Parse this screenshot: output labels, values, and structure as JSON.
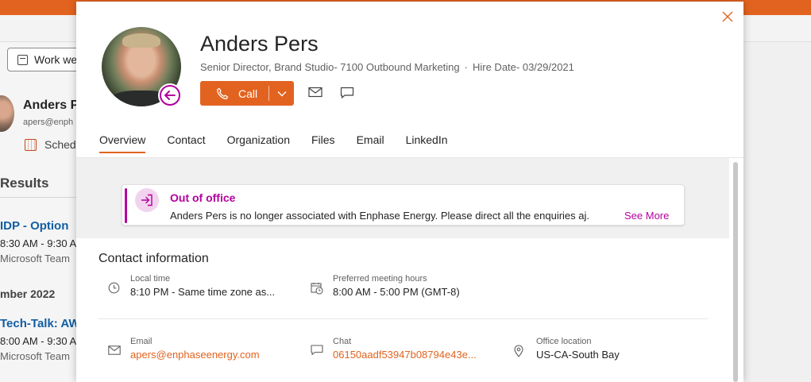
{
  "background": {
    "view_selector": "Work we",
    "person_name": "Anders P",
    "person_email": "apers@enph",
    "schedule": "Schedu",
    "results_heading": "Results",
    "event1": {
      "title": "IDP - Option",
      "time": "8:30 AM - 9:30 A",
      "source": "Microsoft Team"
    },
    "month_label": "mber 2022",
    "event2": {
      "title": "Tech-Talk: AW",
      "time": "8:00 AM - 9:30 A",
      "source": "Microsoft Team"
    }
  },
  "profile": {
    "name": "Anders Pers",
    "title": "Senior Director, Brand Studio- 7100 Outbound Marketing",
    "separator": "·",
    "hire_date": "Hire Date- 03/29/2021",
    "presence_status": "out-of-office",
    "actions": {
      "call_label": "Call"
    }
  },
  "tabs": [
    "Overview",
    "Contact",
    "Organization",
    "Files",
    "Email",
    "LinkedIn"
  ],
  "active_tab": "Overview",
  "out_of_office": {
    "title": "Out of office",
    "message": "Anders Pers is no longer associated with Enphase Energy. Please direct all the enquiries aj.",
    "see_more": "See More"
  },
  "contact_information": {
    "heading": "Contact information",
    "local_time": {
      "label": "Local time",
      "value": "8:10 PM - Same time zone as..."
    },
    "meeting_hours": {
      "label": "Preferred meeting hours",
      "value": "8:00 AM - 5:00 PM (GMT-8)"
    },
    "email": {
      "label": "Email",
      "value": "apers@enphaseenergy.com"
    },
    "chat": {
      "label": "Chat",
      "value": "06150aadf53947b08794e43e..."
    },
    "office_location": {
      "label": "Office location",
      "value": "US-CA-South Bay"
    }
  },
  "colors": {
    "accent": "#e2631f",
    "ooo": "#b4009e",
    "link_blue": "#115ea3"
  },
  "icons": [
    "close-icon",
    "phone-icon",
    "chevron-down-icon",
    "mail-icon",
    "chat-icon",
    "out-of-office-icon",
    "clock-icon",
    "calendar-clock-icon",
    "location-icon"
  ]
}
